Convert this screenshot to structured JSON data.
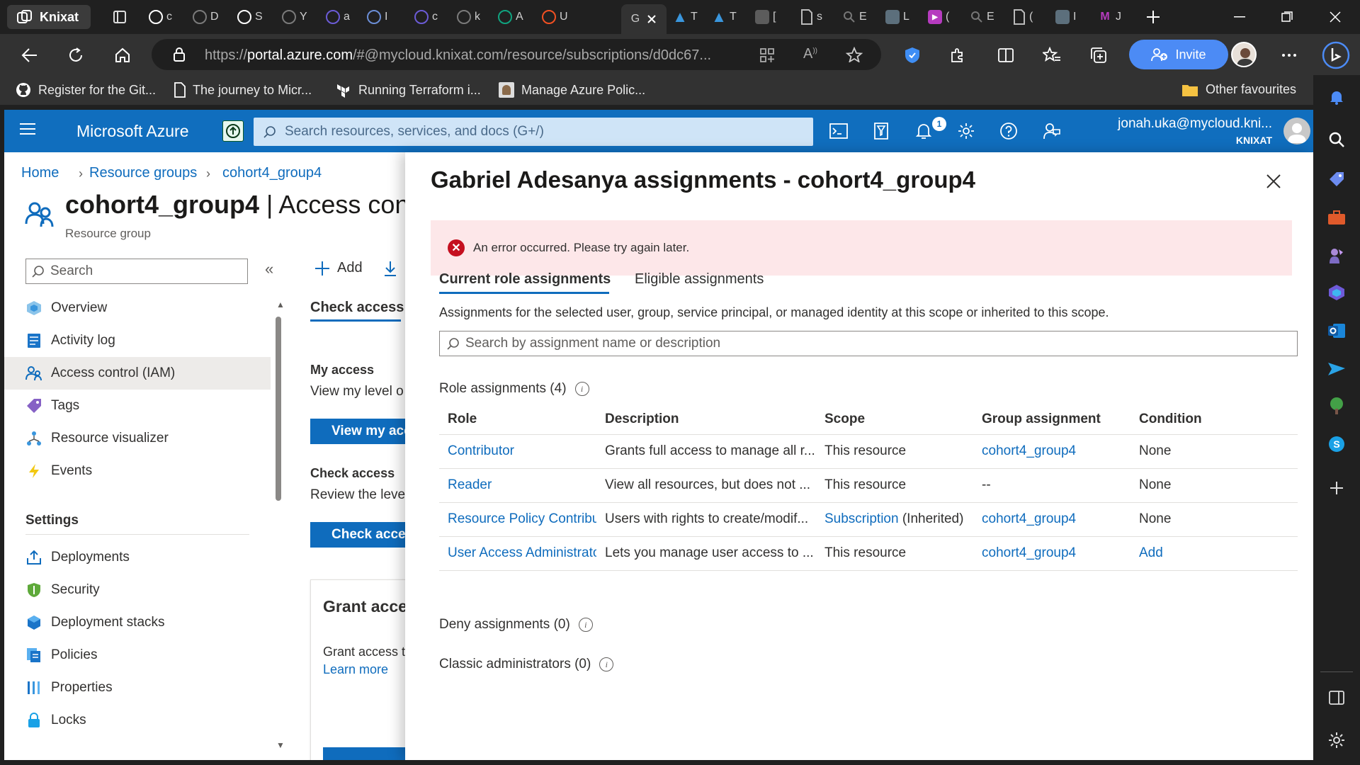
{
  "browser": {
    "profile_name": "Knixat",
    "tabs": [
      {
        "letter": "c",
        "color": "#ffffff"
      },
      {
        "letter": "D",
        "color": "#7a7a7a"
      },
      {
        "letter": "S",
        "color": "#ffffff"
      },
      {
        "letter": "Y",
        "color": "#7a7a7a"
      },
      {
        "letter": "a",
        "color": "#6b5bd6"
      },
      {
        "letter": "I",
        "color": "#6b8ed6"
      },
      {
        "letter": "c",
        "color": "#6b5bd6"
      },
      {
        "letter": "k",
        "color": "#7a7a7a"
      },
      {
        "letter": "A",
        "color": "#10a37f"
      },
      {
        "letter": "U",
        "color": "#f25022"
      }
    ],
    "active_tab_letter": "G",
    "url_prefix": "https://",
    "url_domain": "portal.azure.com",
    "url_rest": "/#@mycloud.knixat.com/resource/subscriptions/d0dc67...",
    "invite_label": "Invite",
    "favourites": [
      {
        "label": "Register for the Git..."
      },
      {
        "label": "The journey to Micr..."
      },
      {
        "label": "Running Terraform i..."
      },
      {
        "label": "Manage Azure Polic..."
      }
    ],
    "other_favourites": "Other favourites"
  },
  "azure": {
    "brand": "Microsoft Azure",
    "search_placeholder": "Search resources, services, and docs (G+/)",
    "notification_count": "1",
    "user_email": "jonah.uka@mycloud.kni...",
    "user_tenant": "KNIXAT",
    "breadcrumb": [
      "Home",
      "Resource groups",
      "cohort4_group4"
    ],
    "page_title_bold": "cohort4_group4",
    "page_title_rest": " | Access cont",
    "page_subtitle": "Resource group",
    "menu_search": "Search",
    "menu_items": [
      {
        "label": "Overview",
        "icon": "overview-icon"
      },
      {
        "label": "Activity log",
        "icon": "activity-log-icon"
      },
      {
        "label": "Access control (IAM)",
        "icon": "iam-icon",
        "active": true
      },
      {
        "label": "Tags",
        "icon": "tag-icon"
      },
      {
        "label": "Resource visualizer",
        "icon": "visualizer-icon"
      },
      {
        "label": "Events",
        "icon": "events-icon"
      }
    ],
    "settings_heading": "Settings",
    "settings_items": [
      {
        "label": "Deployments",
        "icon": "deployments-icon"
      },
      {
        "label": "Security",
        "icon": "security-icon"
      },
      {
        "label": "Deployment stacks",
        "icon": "deployment-stacks-icon"
      },
      {
        "label": "Policies",
        "icon": "policies-icon"
      },
      {
        "label": "Properties",
        "icon": "properties-icon"
      },
      {
        "label": "Locks",
        "icon": "lock-icon"
      }
    ],
    "middle": {
      "add_label": "Add",
      "check_access_tab": "Check access",
      "my_access_head": "My access",
      "my_access_text": "View my level o",
      "view_my_access_btn": "View my acc",
      "check_access_head": "Check access",
      "check_access_text": "Review the leve",
      "check_access_btn": "Check access",
      "grant_title": "Grant acce",
      "grant_text": "Grant access t",
      "learn_more": "Learn more"
    }
  },
  "panel": {
    "title": "Gabriel Adesanya assignments - cohort4_group4",
    "error_message": "An error occurred. Please try again later.",
    "tabs": [
      "Current role assignments",
      "Eligible assignments"
    ],
    "description": "Assignments for the selected user, group, service principal, or managed identity at this scope or inherited to this scope.",
    "search_placeholder": "Search by assignment name or description",
    "role_assignments_label": "Role assignments (4)",
    "columns": [
      "Role",
      "Description",
      "Scope",
      "Group assignment",
      "Condition"
    ],
    "rows": [
      {
        "role": "Contributor",
        "description": "Grants full access to manage all r...",
        "scope": "This resource",
        "scope_suffix": "",
        "group": "cohort4_group4",
        "condition": "None"
      },
      {
        "role": "Reader",
        "description": "View all resources, but does not ...",
        "scope": "This resource",
        "scope_suffix": "",
        "group": "--",
        "condition": "None"
      },
      {
        "role": "Resource Policy Contribu",
        "description": "Users with rights to create/modif...",
        "scope": "Subscription",
        "scope_suffix": " (Inherited)",
        "group": "cohort4_group4",
        "condition": "None"
      },
      {
        "role": "User Access Administrato",
        "description": "Lets you manage user access to ...",
        "scope": "This resource",
        "scope_suffix": "",
        "group": "cohort4_group4",
        "condition": "Add"
      }
    ],
    "deny_label": "Deny assignments (0)",
    "classic_label": "Classic administrators (0)"
  }
}
